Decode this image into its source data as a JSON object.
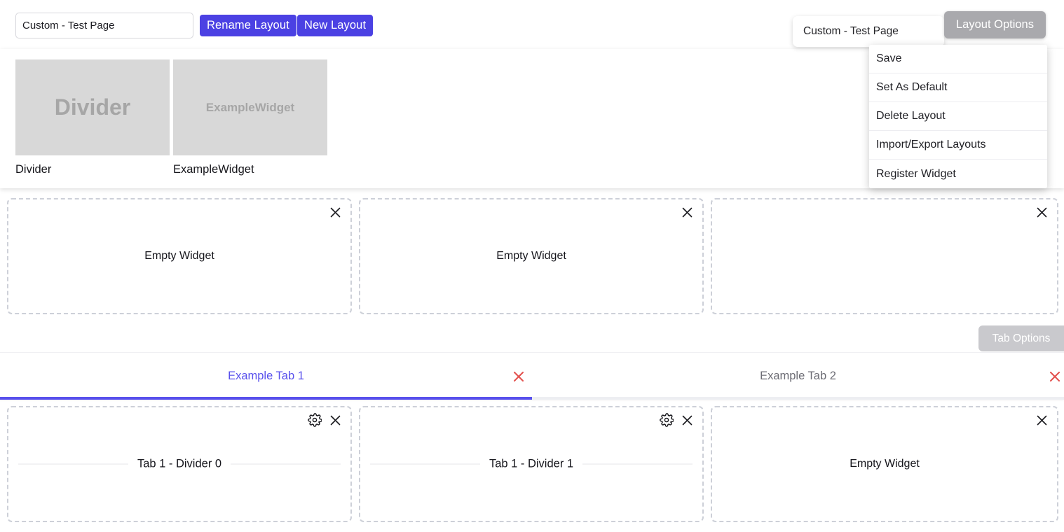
{
  "toolbar": {
    "layout_name_value": "Custom - Test Page",
    "layout_name_placeholder": "Layout name",
    "rename_label": "Rename Layout",
    "new_layout_label": "New Layout",
    "layout_chip_label": "Custom - Test Page",
    "layout_options_label": "Layout Options"
  },
  "layout_options_menu": {
    "items": [
      {
        "label": "Save"
      },
      {
        "label": "Set As Default"
      },
      {
        "label": "Delete Layout"
      },
      {
        "label": "Import/Export Layouts"
      },
      {
        "label": "Register Widget"
      }
    ]
  },
  "palette": {
    "items": [
      {
        "thumb_text": "Divider",
        "caption": "Divider",
        "size": "large"
      },
      {
        "thumb_text": "ExampleWidget",
        "caption": "ExampleWidget",
        "size": "small"
      }
    ]
  },
  "top_widgets": [
    {
      "type": "empty",
      "label": "Empty Widget",
      "has_settings": false
    },
    {
      "type": "empty",
      "label": "Empty Widget",
      "has_settings": false
    },
    {
      "type": "empty",
      "label": "",
      "has_settings": false
    }
  ],
  "tabs": {
    "options_label": "Tab Options",
    "items": [
      {
        "label": "Example Tab 1",
        "active": true
      },
      {
        "label": "Example Tab 2",
        "active": false
      }
    ]
  },
  "bottom_widgets": [
    {
      "type": "divider",
      "label": "Tab 1 - Divider 0",
      "has_settings": true
    },
    {
      "type": "divider",
      "label": "Tab 1 - Divider 1",
      "has_settings": true
    },
    {
      "type": "empty",
      "label": "Empty Widget",
      "has_settings": false
    }
  ],
  "colors": {
    "accent": "#4b41e3",
    "tab_active": "#5850ec",
    "close_red": "#e3524f",
    "disabled_gray": "#a9a9ad",
    "thumb_gray": "#d8d8d8"
  },
  "icons": {
    "close": "close-icon",
    "settings": "gear-icon"
  }
}
